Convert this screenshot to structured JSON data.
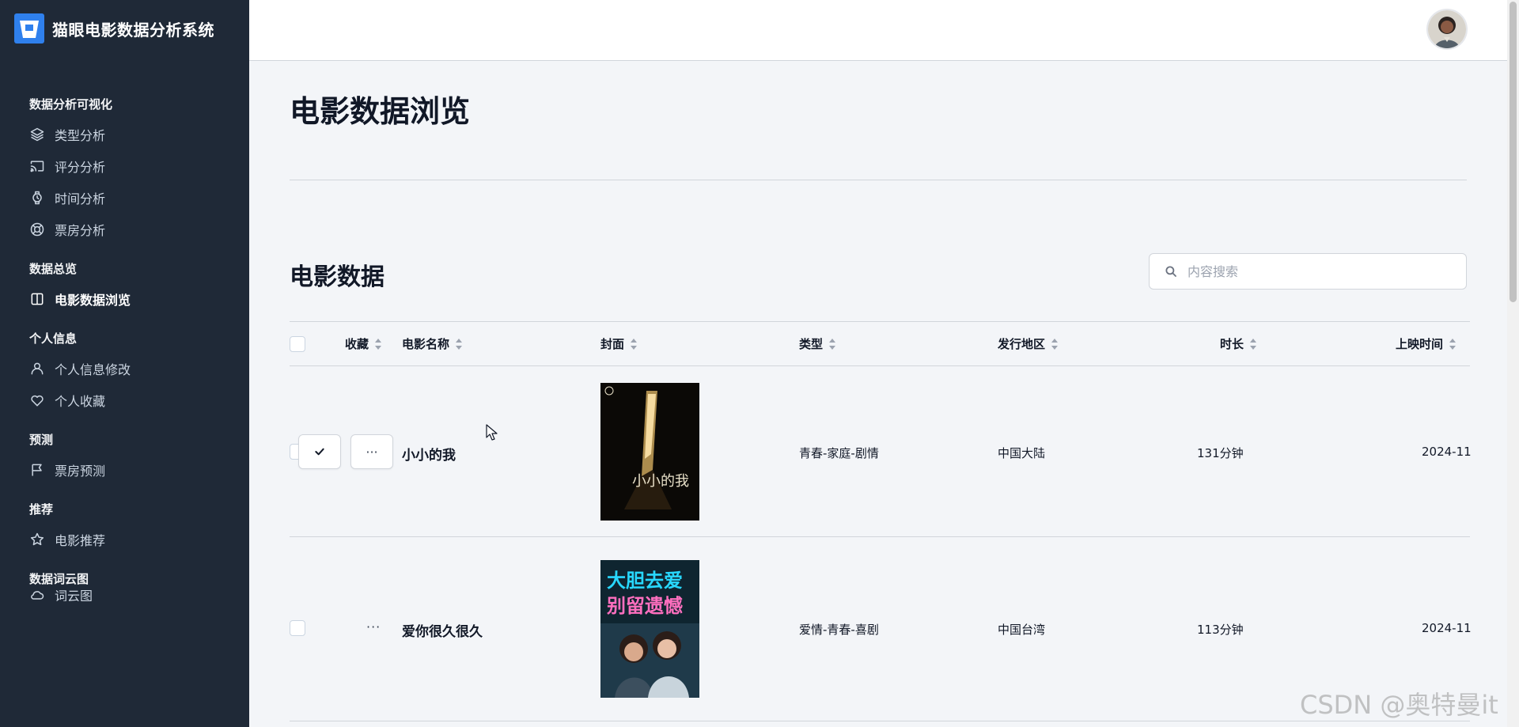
{
  "app": {
    "title": "猫眼电影数据分析系统"
  },
  "sidebar": {
    "sections": [
      {
        "title": "数据分析可视化",
        "items": [
          {
            "label": "类型分析",
            "icon": "layers-icon"
          },
          {
            "label": "评分分析",
            "icon": "cast-icon"
          },
          {
            "label": "时间分析",
            "icon": "watch-icon"
          },
          {
            "label": "票房分析",
            "icon": "lifebuoy-icon"
          }
        ]
      },
      {
        "title": "数据总览",
        "items": [
          {
            "label": "电影数据浏览",
            "icon": "columns-icon",
            "active": true
          }
        ]
      },
      {
        "title": "个人信息",
        "items": [
          {
            "label": "个人信息修改",
            "icon": "user-icon"
          },
          {
            "label": "个人收藏",
            "icon": "heart-icon"
          }
        ]
      },
      {
        "title": "预测",
        "items": [
          {
            "label": "票房预测",
            "icon": "flag-icon"
          }
        ]
      },
      {
        "title": "推荐",
        "items": [
          {
            "label": "电影推荐",
            "icon": "star-icon"
          }
        ]
      },
      {
        "title": "数据词云图",
        "items": [
          {
            "label": "词云图",
            "icon": "cloud-icon"
          }
        ]
      }
    ]
  },
  "main": {
    "page_title": "电影数据浏览",
    "section_title": "电影数据",
    "search": {
      "placeholder": "内容搜索",
      "value": ""
    }
  },
  "table": {
    "columns": [
      "收藏",
      "电影名称",
      "封面",
      "类型",
      "发行地区",
      "时长",
      "上映时间"
    ],
    "rows": [
      {
        "name": "小小的我",
        "genre": "青春-家庭-剧情",
        "region": "中国大陆",
        "duration": "131分钟",
        "release": "2024-11"
      },
      {
        "name": "爱你很久很久",
        "genre": "爱情-青春-喜剧",
        "region": "中国台湾",
        "duration": "113分钟",
        "release": "2024-11"
      }
    ],
    "row_actions": {
      "more": "···"
    }
  },
  "posters": {
    "poster2_line1": "大胆去爱",
    "poster2_line2": "别留遗憾",
    "poster1_text": "小小的我"
  },
  "watermark": "CSDN @奥特曼it"
}
